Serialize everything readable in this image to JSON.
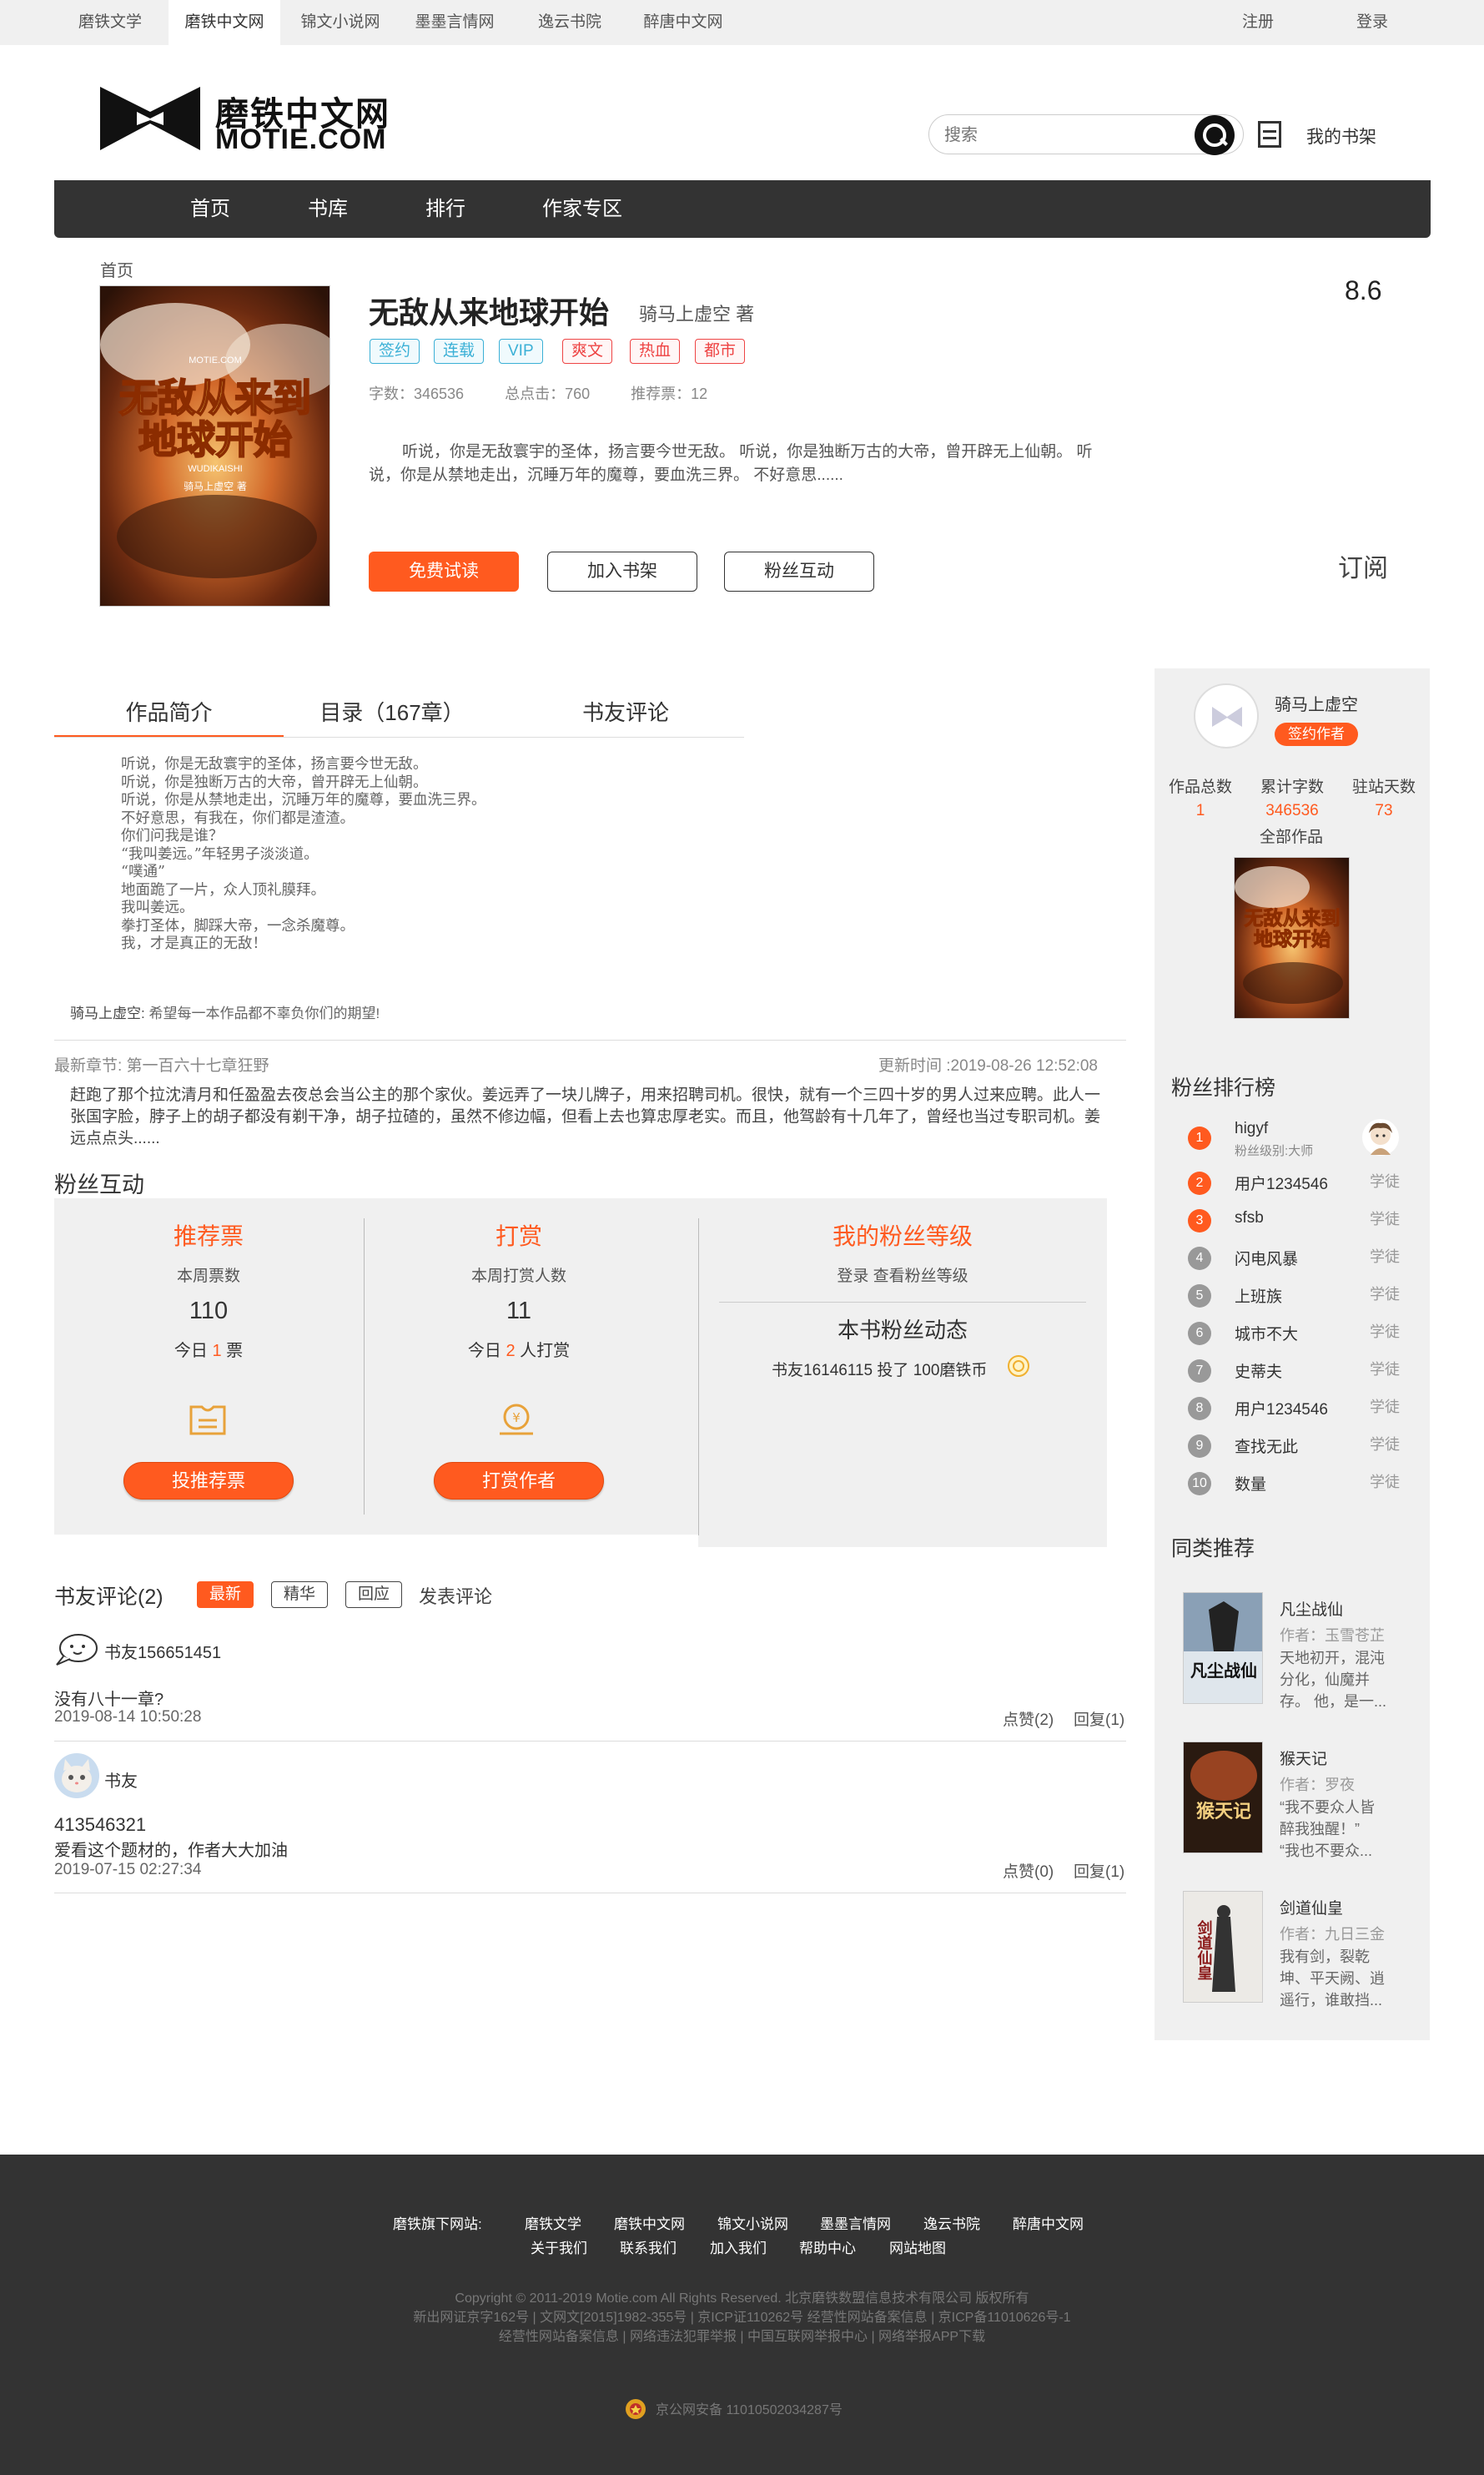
{
  "topbar": {
    "sites": [
      "磨铁文学",
      "磨铁中文网",
      "锦文小说网",
      "墨墨言情网",
      "逸云书院",
      "醉唐中文网"
    ],
    "register": "注册",
    "login": "登录"
  },
  "header": {
    "logo_cn": "磨铁中文网",
    "logo_en": "MOTIE.COM",
    "search_placeholder": "搜索",
    "shelf_label": "我的书架"
  },
  "nav": [
    "首页",
    "书库",
    "排行",
    "作家专区"
  ],
  "breadcrumb": "首页",
  "book": {
    "title": "无敌从来地球开始",
    "author": "骑马上虚空 著",
    "score": "8.6",
    "tags": [
      {
        "label": "签约",
        "color": "blue"
      },
      {
        "label": "连载",
        "color": "blue"
      },
      {
        "label": "VIP",
        "color": "blue"
      },
      {
        "label": "爽文",
        "color": "red"
      },
      {
        "label": "热血",
        "color": "red"
      },
      {
        "label": "都市",
        "color": "red"
      }
    ],
    "stats": [
      "字数：346536",
      "总点击：760",
      "推荐票：12"
    ],
    "intro": "听说，你是无敌寰宇的圣体，扬言要今世无敌。 听说，你是独断万古的大帝，曾开辟无上仙朝。 听说，你是从禁地走出，沉睡万年的魔尊，要血洗三界。 不好意思......",
    "cover_brand": "MOTIE.COM",
    "cover_line1": "无敌从来到",
    "cover_line2": "地球开始",
    "cover_pinyin": "WUDIKAISHI",
    "cover_author": "骑马上虚空 著",
    "buttons": {
      "trial": "免费试读",
      "add_shelf": "加入书架",
      "fans": "粉丝互动"
    },
    "subscribe": "订阅"
  },
  "tabs": [
    "作品简介",
    "目录（167章）",
    "书友评论"
  ],
  "excerpt": [
    "听说，你是无敌寰宇的圣体，扬言要今世无敌。",
    "听说，你是独断万古的大帝，曾开辟无上仙朝。",
    "听说，你是从禁地走出，沉睡万年的魔尊，要血洗三界。",
    "不好意思，有我在，你们都是渣渣。",
    "你们问我是谁？",
    "“我叫姜远。”年轻男子淡淡道。",
    "“噗通”",
    "地面跪了一片，众人顶礼膜拜。",
    "我叫姜远。",
    "拳打圣体，脚踩大帝，一念杀魔尊。",
    "我，才是真正的无敌！"
  ],
  "author_message": {
    "name": "骑马上虚空:",
    "text": " 希望每一本作品都不辜负你们的期望!"
  },
  "latest": {
    "label": "最新章节: 第一百六十七章狂野",
    "update_time": "更新时间 :2019-08-26 12:52:08",
    "text": "赶跑了那个拉沈清月和任盈盈去夜总会当公主的那个家伙。姜远弄了一块儿牌子，用来招聘司机。很快，就有一个三四十岁的男人过来应聘。此人一张国字脸，脖子上的胡子都没有剃干净，胡子拉碴的，虽然不修边幅，但看上去也算忠厚老实。而且，他驾龄有十几年了，曾经也当过专职司机。姜远点点头......"
  },
  "fan": {
    "heading": "粉丝互动",
    "vote": {
      "title": "推荐票",
      "label": "本周票数",
      "value": "110",
      "today_pre": "今日 ",
      "today_num": "1",
      "today_post": " 票",
      "button": "投推荐票"
    },
    "reward": {
      "title": "打赏",
      "label": "本周打赏人数",
      "value": "11",
      "today_pre": "今日 ",
      "today_num": "2",
      "today_post": " 人打赏",
      "button": "打赏作者"
    },
    "level": {
      "title": "我的粉丝等级",
      "login": "登录",
      "check": " 查看粉丝等级",
      "feed_title": "本书粉丝动态",
      "feed_user": "书友16146115",
      "feed_action": " 投了 ",
      "feed_amount": "100磨铁币"
    }
  },
  "reviews": {
    "heading": "书友评论(2)",
    "filters": [
      "最新",
      "精华",
      "回应"
    ],
    "post": "发表评论",
    "items": [
      {
        "user": "书友156651451",
        "text": "没有八十一章?",
        "time": "2019-08-14 10:50:28",
        "likes": "点赞(2)",
        "replies": "回复(1)"
      },
      {
        "user": "书友",
        "text_line1": "413546321",
        "text_line2": "爱看这个题材的，作者大大加油",
        "time": "2019-07-15 02:27:34",
        "likes": "点赞(0)",
        "replies": "回复(1)"
      }
    ]
  },
  "sidebar": {
    "author_name": "骑马上虚空",
    "author_badge": "签约作者",
    "stats": [
      {
        "label": "作品总数",
        "value": "1"
      },
      {
        "label": "累计字数",
        "value": "346536"
      },
      {
        "label": "驻站天数",
        "value": "73"
      }
    ],
    "all_works": "全部作品",
    "rank_heading": "粉丝排行榜",
    "rank": [
      {
        "num": "1",
        "name": "higyf",
        "level": "",
        "sub": "粉丝级别:大师"
      },
      {
        "num": "2",
        "name": "用户1234546",
        "level": "学徒"
      },
      {
        "num": "3",
        "name": "sfsb",
        "level": "学徒"
      },
      {
        "num": "4",
        "name": "闪电风暴",
        "level": "学徒"
      },
      {
        "num": "5",
        "name": "上班族",
        "level": "学徒"
      },
      {
        "num": "6",
        "name": "城市不大",
        "level": "学徒"
      },
      {
        "num": "7",
        "name": "史蒂夫",
        "level": "学徒"
      },
      {
        "num": "8",
        "name": "用户1234546",
        "level": "学徒"
      },
      {
        "num": "9",
        "name": "查找无此",
        "level": "学徒"
      },
      {
        "num": "10",
        "name": "数量",
        "level": "学徒"
      }
    ],
    "similar_heading": "同类推荐",
    "similar": [
      {
        "title": "凡尘战仙",
        "author": "作者：玉雪苍芷",
        "desc1": "天地初开，混沌",
        "desc2": "分化，仙魔并",
        "desc3": "存。 他，是一..."
      },
      {
        "title": "猴天记",
        "author": "作者：罗夜",
        "desc1": "“我不要众人皆",
        "desc2": "醉我独醒！”",
        "desc3": "“我也不要众..."
      },
      {
        "title": "剑道仙皇",
        "author": "作者：九日三金",
        "desc1": "我有剑，裂乾",
        "desc2": "坤、平天阙、逍",
        "desc3": "遥行，谁敢挡..."
      }
    ]
  },
  "footer": {
    "sites_label": "磨铁旗下网站:",
    "sites": [
      "磨铁文学",
      "磨铁中文网",
      "锦文小说网",
      "墨墨言情网",
      "逸云书院",
      "醉唐中文网"
    ],
    "links": [
      "关于我们",
      "联系我们",
      "加入我们",
      "帮助中心",
      "网站地图"
    ],
    "copy1": "Copyright © 2011-2019 Motie.com All Rights Reserved. 北京磨铁数盟信息技术有限公司 版权所有",
    "copy2": "新出网证京字162号 | 文网文[2015]1982-355号 | 京ICP证110262号 经营性网站备案信息 | 京ICP备11010626号-1",
    "copy3": "经营性网站备案信息 | 网络违法犯罪举报 | 中国互联网举报中心 | 网络举报APP下载",
    "police": "京公网安备 11010502034287号"
  },
  "colors": {
    "accent": "#ff5a1f",
    "dark": "#333333",
    "panel": "#f0f0f0",
    "tag_blue": "#3bb0d6",
    "tag_red": "#ee4444"
  }
}
